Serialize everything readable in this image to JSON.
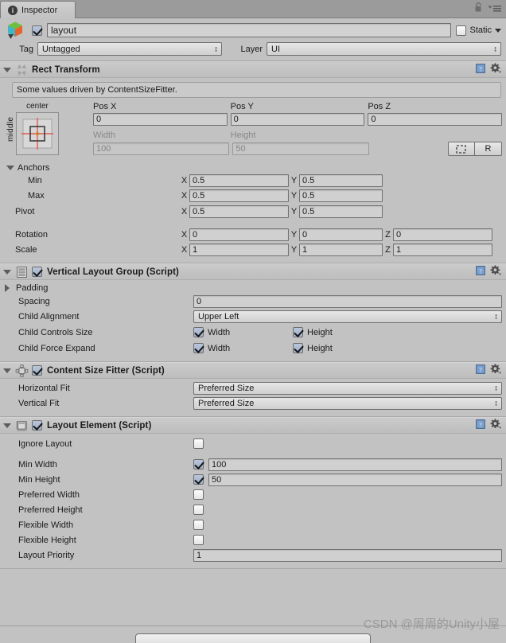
{
  "window": {
    "tab_label": "Inspector",
    "tab_icon": "info-icon",
    "lock_icon": "lock-icon",
    "menu_icon": "hamburger-menu-icon"
  },
  "gameobject": {
    "icon": "prefab-cube-icon",
    "enabled": true,
    "name": "layout",
    "static_label": "Static",
    "static_checked": false,
    "tag_label": "Tag",
    "tag_value": "Untagged",
    "layer_label": "Layer",
    "layer_value": "UI"
  },
  "components": [
    {
      "title": "Rect Transform",
      "icon": "rect-transform-icon",
      "expanded": true,
      "has_enable_checkbox": false,
      "help_icon": "help-book-icon",
      "settings_icon": "gear-icon",
      "info_message": "Some values driven by ContentSizeFitter.",
      "anchor_preset": {
        "top_label": "center",
        "side_label": "middle"
      },
      "pos_headers": [
        "Pos X",
        "Pos Y",
        "Pos Z"
      ],
      "pos_values": [
        "0",
        "0",
        "0"
      ],
      "size_headers": [
        "Width",
        "Height"
      ],
      "size_values": [
        "100",
        "50"
      ],
      "blueprint_button": "blueprint-mode-icon",
      "raw_button": "R",
      "anchors_label": "Anchors",
      "anchor_rows": [
        {
          "label": "Min",
          "x_axis": "X",
          "x": "0.5",
          "y_axis": "Y",
          "y": "0.5"
        },
        {
          "label": "Max",
          "x_axis": "X",
          "x": "0.5",
          "y_axis": "Y",
          "y": "0.5"
        }
      ],
      "pivot_row": {
        "label": "Pivot",
        "x_axis": "X",
        "x": "0.5",
        "y_axis": "Y",
        "y": "0.5"
      },
      "transform_rows": [
        {
          "label": "Rotation",
          "x_axis": "X",
          "x": "0",
          "y_axis": "Y",
          "y": "0",
          "z_axis": "Z",
          "z": "0"
        },
        {
          "label": "Scale",
          "x_axis": "X",
          "x": "1",
          "y_axis": "Y",
          "y": "1",
          "z_axis": "Z",
          "z": "1"
        }
      ]
    },
    {
      "title": "Vertical Layout Group (Script)",
      "icon": "vertical-layout-group-icon",
      "expanded": true,
      "has_enable_checkbox": true,
      "enabled": true,
      "help_icon": "help-book-icon",
      "settings_icon": "gear-icon",
      "padding_label": "Padding",
      "spacing_label": "Spacing",
      "spacing_value": "0",
      "child_alignment_label": "Child Alignment",
      "child_alignment_value": "Upper Left",
      "child_controls_size_label": "Child Controls Size",
      "child_force_expand_label": "Child Force Expand",
      "width_label": "Width",
      "height_label": "Height",
      "controls_width": true,
      "controls_height": true,
      "expand_width": true,
      "expand_height": true
    },
    {
      "title": "Content Size Fitter (Script)",
      "icon": "content-size-fitter-icon",
      "expanded": true,
      "has_enable_checkbox": true,
      "enabled": true,
      "help_icon": "help-book-icon",
      "settings_icon": "gear-icon",
      "horizontal_fit_label": "Horizontal Fit",
      "horizontal_fit_value": "Preferred Size",
      "vertical_fit_label": "Vertical Fit",
      "vertical_fit_value": "Preferred Size"
    },
    {
      "title": "Layout Element (Script)",
      "icon": "layout-element-icon",
      "expanded": true,
      "has_enable_checkbox": true,
      "enabled": true,
      "help_icon": "help-book-icon",
      "settings_icon": "gear-icon",
      "ignore_layout_label": "Ignore Layout",
      "ignore_layout_checked": false,
      "fields": [
        {
          "label": "Min Width",
          "checked": true,
          "value": "100"
        },
        {
          "label": "Min Height",
          "checked": true,
          "value": "50"
        },
        {
          "label": "Preferred Width",
          "checked": false,
          "value": ""
        },
        {
          "label": "Preferred Height",
          "checked": false,
          "value": ""
        },
        {
          "label": "Flexible Width",
          "checked": false,
          "value": ""
        },
        {
          "label": "Flexible Height",
          "checked": false,
          "value": ""
        }
      ],
      "layout_priority_label": "Layout Priority",
      "layout_priority_value": "1"
    }
  ],
  "watermark": "CSDN @周周的Unity小屋"
}
